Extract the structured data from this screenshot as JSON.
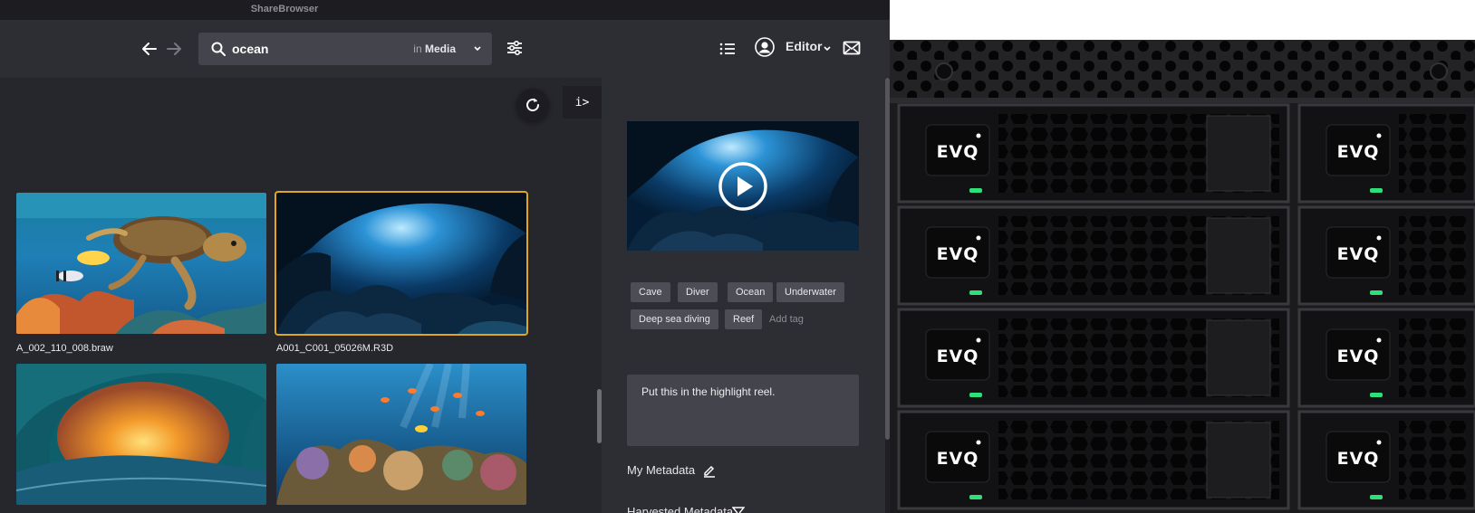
{
  "window": {
    "title": "ShareBrowser"
  },
  "search": {
    "query": "ocean",
    "scope_prefix": "in",
    "scope": "Media"
  },
  "user": {
    "role": "Editor"
  },
  "grid": {
    "items": [
      {
        "filename": "A_002_110_008.braw",
        "selected": false,
        "icon": "sea-turtle-reef-thumbnail"
      },
      {
        "filename": "A001_C001_05026M.R3D",
        "selected": true,
        "icon": "underwater-cave-thumbnail"
      },
      {
        "filename": "",
        "selected": false,
        "icon": "wave-sunset-thumbnail"
      },
      {
        "filename": "",
        "selected": false,
        "icon": "coral-reef-fish-thumbnail"
      }
    ]
  },
  "info_panel": {
    "toggle_label": "i>",
    "tags": [
      "Cave",
      "Diver",
      "Ocean",
      "Underwater",
      "Deep sea diving",
      "Reef"
    ],
    "add_tag_label": "Add tag",
    "comment": "Put this in the highlight reel.",
    "my_metadata_label": "My Metadata",
    "harvested_metadata_label": "Harvested Metadata"
  },
  "hardware": {
    "brand_label": "EVQ",
    "colors": {
      "led": "#2ee07a",
      "chassis": "#1a1a1c"
    }
  },
  "colors": {
    "selection": "#e2a51b",
    "panel": "#2d2d34",
    "background": "#26262d"
  }
}
